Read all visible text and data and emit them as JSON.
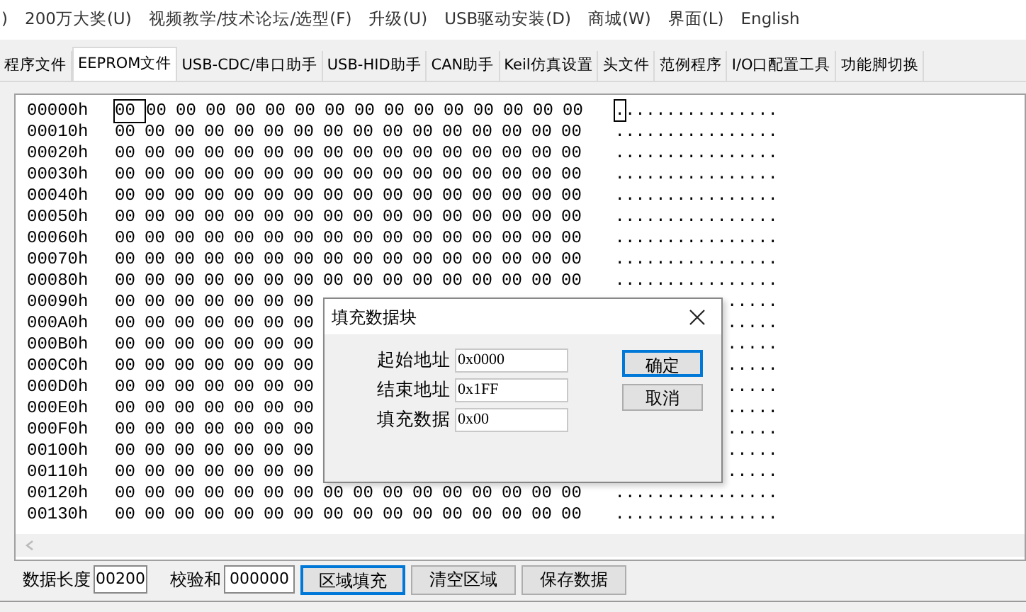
{
  "menu": [
    ")",
    "200万大奖(U)",
    "视频教学/技术论坛/选型(F)",
    "升级(U)",
    "USB驱动安装(D)",
    "商城(W)",
    "界面(L)",
    "English"
  ],
  "tabs": [
    {
      "label": "程序文件",
      "selected": false
    },
    {
      "label": "EEPROM文件",
      "selected": true
    },
    {
      "label": "USB-CDC/串口助手",
      "selected": false
    },
    {
      "label": "USB-HID助手",
      "selected": false
    },
    {
      "label": "CAN助手",
      "selected": false
    },
    {
      "label": "Keil仿真设置",
      "selected": false
    },
    {
      "label": "头文件",
      "selected": false
    },
    {
      "label": "范例程序",
      "selected": false
    },
    {
      "label": "I/O口配置工具",
      "selected": false
    },
    {
      "label": "功能脚切换",
      "selected": false
    }
  ],
  "hex_rows": [
    {
      "address": "00000h",
      "selected": true,
      "bytes": [
        "00",
        "00",
        "00",
        "00",
        "00",
        "00",
        "00",
        "00",
        "00",
        "00",
        "00",
        "00",
        "00",
        "00",
        "00",
        "00"
      ],
      "ascii": "................"
    },
    {
      "address": "00010h",
      "selected": false,
      "bytes": [
        "00",
        "00",
        "00",
        "00",
        "00",
        "00",
        "00",
        "00",
        "00",
        "00",
        "00",
        "00",
        "00",
        "00",
        "00",
        "00"
      ],
      "ascii": "................"
    },
    {
      "address": "00020h",
      "selected": false,
      "bytes": [
        "00",
        "00",
        "00",
        "00",
        "00",
        "00",
        "00",
        "00",
        "00",
        "00",
        "00",
        "00",
        "00",
        "00",
        "00",
        "00"
      ],
      "ascii": "................"
    },
    {
      "address": "00030h",
      "selected": false,
      "bytes": [
        "00",
        "00",
        "00",
        "00",
        "00",
        "00",
        "00",
        "00",
        "00",
        "00",
        "00",
        "00",
        "00",
        "00",
        "00",
        "00"
      ],
      "ascii": "................"
    },
    {
      "address": "00040h",
      "selected": false,
      "bytes": [
        "00",
        "00",
        "00",
        "00",
        "00",
        "00",
        "00",
        "00",
        "00",
        "00",
        "00",
        "00",
        "00",
        "00",
        "00",
        "00"
      ],
      "ascii": "................"
    },
    {
      "address": "00050h",
      "selected": false,
      "bytes": [
        "00",
        "00",
        "00",
        "00",
        "00",
        "00",
        "00",
        "00",
        "00",
        "00",
        "00",
        "00",
        "00",
        "00",
        "00",
        "00"
      ],
      "ascii": "................"
    },
    {
      "address": "00060h",
      "selected": false,
      "bytes": [
        "00",
        "00",
        "00",
        "00",
        "00",
        "00",
        "00",
        "00",
        "00",
        "00",
        "00",
        "00",
        "00",
        "00",
        "00",
        "00"
      ],
      "ascii": "................"
    },
    {
      "address": "00070h",
      "selected": false,
      "bytes": [
        "00",
        "00",
        "00",
        "00",
        "00",
        "00",
        "00",
        "00",
        "00",
        "00",
        "00",
        "00",
        "00",
        "00",
        "00",
        "00"
      ],
      "ascii": "................"
    },
    {
      "address": "00080h",
      "selected": false,
      "bytes": [
        "00",
        "00",
        "00",
        "00",
        "00",
        "00",
        "00",
        "00",
        "00",
        "00",
        "00",
        "00",
        "00",
        "00",
        "00",
        "00"
      ],
      "ascii": "................"
    },
    {
      "address": "00090h",
      "selected": false,
      "bytes": [
        "00",
        "00",
        "00",
        "00",
        "00",
        "00",
        "00"
      ],
      "ascii": "....."
    },
    {
      "address": "000A0h",
      "selected": false,
      "bytes": [
        "00",
        "00",
        "00",
        "00",
        "00",
        "00",
        "00"
      ],
      "ascii": "....."
    },
    {
      "address": "000B0h",
      "selected": false,
      "bytes": [
        "00",
        "00",
        "00",
        "00",
        "00",
        "00",
        "00"
      ],
      "ascii": "....."
    },
    {
      "address": "000C0h",
      "selected": false,
      "bytes": [
        "00",
        "00",
        "00",
        "00",
        "00",
        "00",
        "00"
      ],
      "ascii": "....."
    },
    {
      "address": "000D0h",
      "selected": false,
      "bytes": [
        "00",
        "00",
        "00",
        "00",
        "00",
        "00",
        "00"
      ],
      "ascii": "....."
    },
    {
      "address": "000E0h",
      "selected": false,
      "bytes": [
        "00",
        "00",
        "00",
        "00",
        "00",
        "00",
        "00"
      ],
      "ascii": "....."
    },
    {
      "address": "000F0h",
      "selected": false,
      "bytes": [
        "00",
        "00",
        "00",
        "00",
        "00",
        "00",
        "00"
      ],
      "ascii": "....."
    },
    {
      "address": "00100h",
      "selected": false,
      "bytes": [
        "00",
        "00",
        "00",
        "00",
        "00",
        "00",
        "00"
      ],
      "ascii": "....."
    },
    {
      "address": "00110h",
      "selected": false,
      "bytes": [
        "00",
        "00",
        "00",
        "00",
        "00",
        "00",
        "00"
      ],
      "ascii": "....."
    },
    {
      "address": "00120h",
      "selected": false,
      "bytes": [
        "00",
        "00",
        "00",
        "00",
        "00",
        "00",
        "00",
        "00",
        "00",
        "00",
        "00",
        "00",
        "00",
        "00",
        "00",
        "00"
      ],
      "ascii": "................"
    },
    {
      "address": "00130h",
      "selected": false,
      "bytes": [
        "00",
        "00",
        "00",
        "00",
        "00",
        "00",
        "00",
        "00",
        "00",
        "00",
        "00",
        "00",
        "00",
        "00",
        "00",
        "00"
      ],
      "ascii": "................"
    }
  ],
  "dialog": {
    "title": "填充数据块",
    "fields": [
      {
        "label": "起始地址",
        "value": "0x0000"
      },
      {
        "label": "结束地址",
        "value": "0x1FF"
      },
      {
        "label": "填充数据",
        "value": "0x00"
      }
    ],
    "buttons": [
      {
        "label": "确定",
        "selected": true
      },
      {
        "label": "取消",
        "selected": false
      }
    ]
  },
  "bottom_bar": {
    "length_label": "数据长度",
    "length_value": "00200",
    "checksum_label": "校验和",
    "checksum_value": "000000",
    "buttons": [
      {
        "label": "区域填充",
        "selected": true
      },
      {
        "label": "清空区域",
        "selected": false
      },
      {
        "label": "保存数据",
        "selected": false
      }
    ]
  }
}
